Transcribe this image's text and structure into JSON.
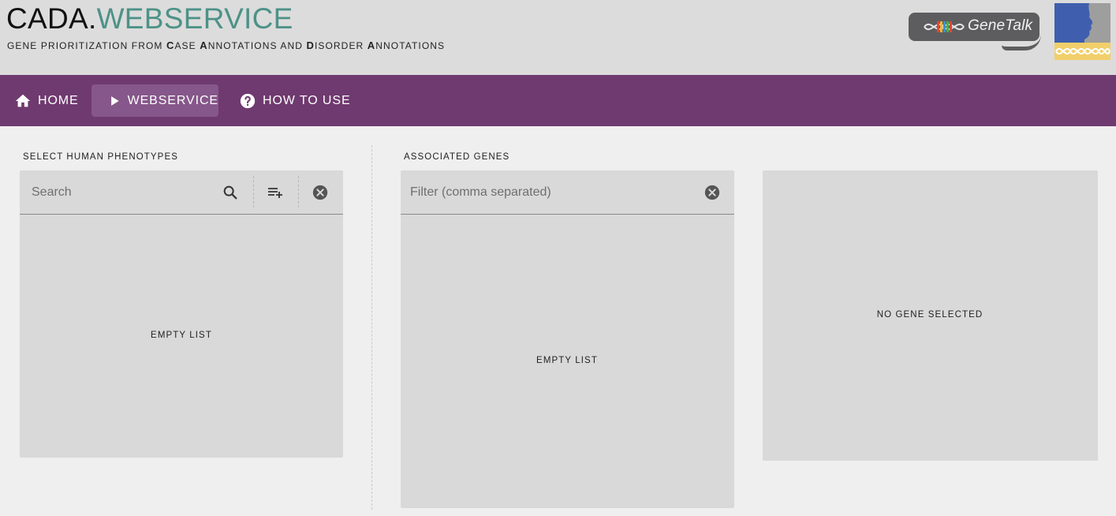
{
  "header": {
    "title_part1": "CADA.",
    "title_part2": "WEBSERVICE",
    "subtitle": {
      "p1": "GENE PRIORITIZATION FROM ",
      "c": "C",
      "ase": "ASE",
      "a1": "A",
      "nnotations1": "NNOTATIONS",
      "and": " AND ",
      "d": "D",
      "isorder": "ISORDER",
      "a2": "A",
      "nnotations2": "NNOTATIONS"
    },
    "partner_logo_text": "GeneTalk"
  },
  "nav": {
    "home_label": "HOME",
    "webservice_label": "WEBSERVICE",
    "howto_label": "HOW TO USE",
    "active": "webservice"
  },
  "phenotypes": {
    "section_label": "SELECT HUMAN PHENOTYPES",
    "search_placeholder": "Search",
    "empty_text": "EMPTY LIST"
  },
  "genes": {
    "section_label": "ASSOCIATED GENES",
    "filter_placeholder": "Filter (comma separated)",
    "empty_text": "EMPTY LIST"
  },
  "gene_detail": {
    "empty_text": "NO GENE SELECTED"
  },
  "colors": {
    "navbar": "#6f3a6f",
    "nav_active": "#86578a",
    "brand_accent": "#4d9287",
    "header_bg": "#dcdcdc",
    "panel_bg": "#d9d9d9"
  },
  "icons": {
    "home": "home-icon",
    "webservice": "play-icon",
    "howto": "help-circle-icon",
    "search": "search-icon",
    "add_list": "playlist-add-icon",
    "clear": "close-circle-icon"
  }
}
